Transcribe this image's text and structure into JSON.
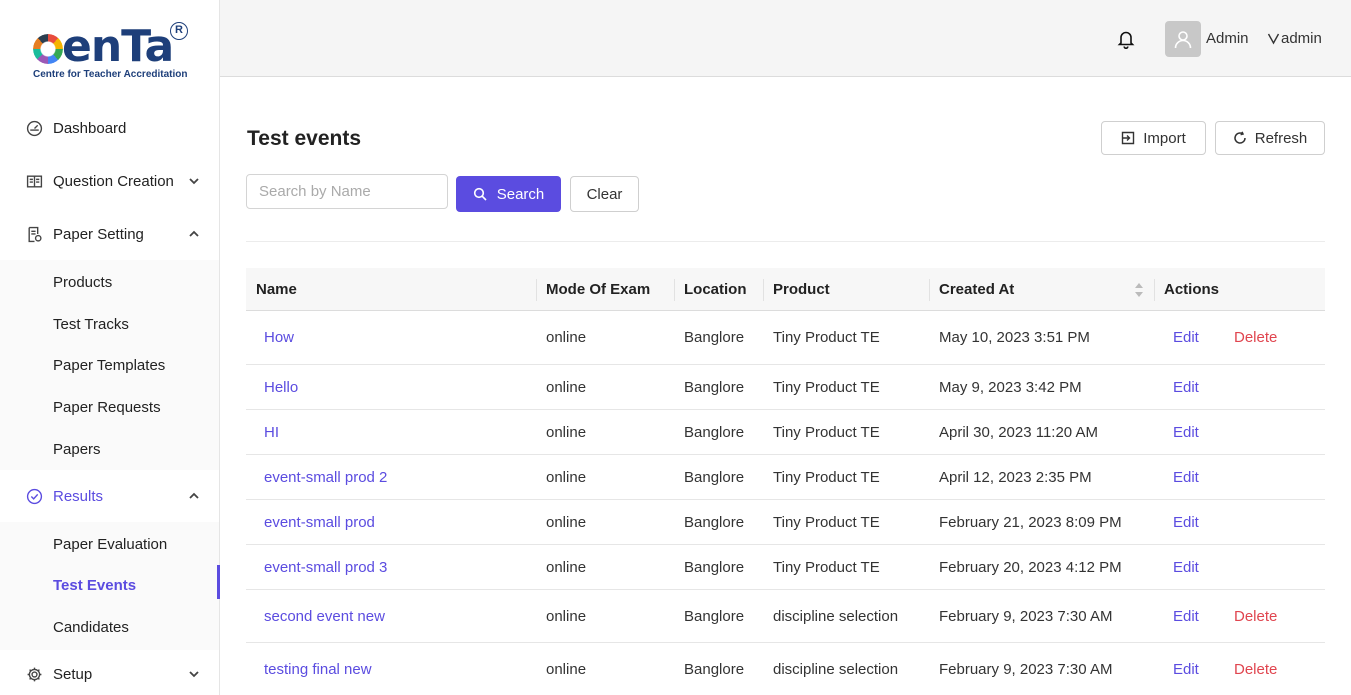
{
  "brand": {
    "logo_text": "cenTa",
    "tagline": "Centre for Teacher Accreditation",
    "reg_mark": "R"
  },
  "sidebar": {
    "items": [
      {
        "label": "Dashboard",
        "icon": "dashboard-icon"
      },
      {
        "label": "Question Creation",
        "icon": "book-icon",
        "expanded": false
      },
      {
        "label": "Paper Setting",
        "icon": "paper-setting-icon",
        "expanded": true,
        "children": [
          "Products",
          "Test Tracks",
          "Paper Templates",
          "Paper Requests",
          "Papers"
        ]
      },
      {
        "label": "Results",
        "icon": "check-circle-icon",
        "expanded": true,
        "children": [
          "Paper Evaluation",
          "Test Events",
          "Candidates"
        ],
        "active_child": "Test Events"
      },
      {
        "label": "Setup",
        "icon": "gear-icon",
        "expanded": false
      }
    ]
  },
  "header": {
    "user_name": "Admin",
    "user_menu": "admin"
  },
  "page": {
    "title": "Test events",
    "import_label": "Import",
    "refresh_label": "Refresh",
    "search_placeholder": "Search by Name",
    "search_label": "Search",
    "clear_label": "Clear"
  },
  "table": {
    "columns": [
      "Name",
      "Mode Of Exam",
      "Location",
      "Product",
      "Created At",
      "Actions"
    ],
    "sortable_column": "Created At",
    "rows": [
      {
        "name": "How",
        "mode": "online",
        "location": "Banglore",
        "product": "Tiny Product TE",
        "created": "May 10, 2023 3:51 PM",
        "edit": "Edit",
        "delete": "Delete"
      },
      {
        "name": "Hello",
        "mode": "online",
        "location": "Banglore",
        "product": "Tiny Product TE",
        "created": "May 9, 2023 3:42 PM",
        "edit": "Edit",
        "delete": ""
      },
      {
        "name": "HI",
        "mode": "online",
        "location": "Banglore",
        "product": "Tiny Product TE",
        "created": "April 30, 2023 11:20 AM",
        "edit": "Edit",
        "delete": ""
      },
      {
        "name": "event-small prod 2",
        "mode": "online",
        "location": "Banglore",
        "product": "Tiny Product TE",
        "created": "April 12, 2023 2:35 PM",
        "edit": "Edit",
        "delete": ""
      },
      {
        "name": "event-small prod",
        "mode": "online",
        "location": "Banglore",
        "product": "Tiny Product TE",
        "created": "February 21, 2023 8:09 PM",
        "edit": "Edit",
        "delete": ""
      },
      {
        "name": "event-small prod 3",
        "mode": "online",
        "location": "Banglore",
        "product": "Tiny Product TE",
        "created": "February 20, 2023 4:12 PM",
        "edit": "Edit",
        "delete": ""
      },
      {
        "name": "second event new",
        "mode": "online",
        "location": "Banglore",
        "product": "discipline selection",
        "created": "February 9, 2023 7:30 AM",
        "edit": "Edit",
        "delete": "Delete"
      },
      {
        "name": "testing final new",
        "mode": "online",
        "location": "Banglore",
        "product": "discipline selection",
        "created": "February 9, 2023 7:30 AM",
        "edit": "Edit",
        "delete": "Delete"
      }
    ]
  },
  "colors": {
    "accent": "#5b4ce0",
    "danger": "#e0454f",
    "header_bg": "#f5f5f5"
  }
}
